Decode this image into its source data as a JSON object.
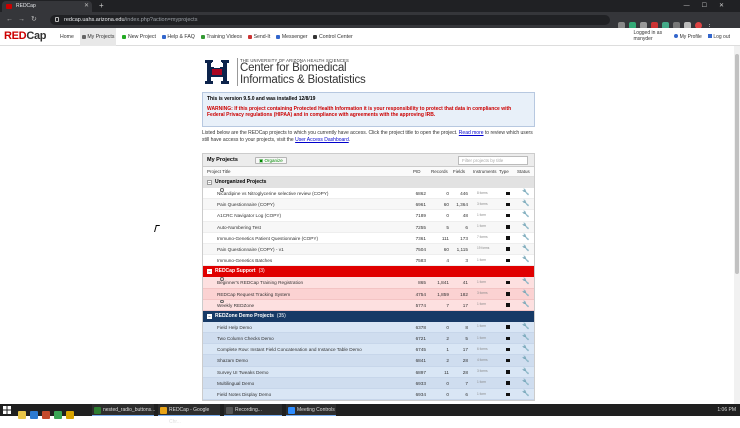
{
  "browser": {
    "tab_title": "REDCap",
    "url_host": "redcap.uahs.arizona.edu",
    "url_path": "/index.php?action=myprojects"
  },
  "nav": {
    "logo_red": "RED",
    "logo_dark": "Cap",
    "items": [
      {
        "label": "Home",
        "color": "#666"
      },
      {
        "label": "My Projects",
        "color": "#666",
        "active": true
      },
      {
        "label": "New Project",
        "color": "#2a2"
      },
      {
        "label": "Help & FAQ",
        "color": "#36c"
      },
      {
        "label": "Training Videos",
        "color": "#393"
      },
      {
        "label": "Send-It",
        "color": "#c33"
      },
      {
        "label": "Messenger",
        "color": "#36c"
      },
      {
        "label": "Control Center",
        "color": "#333"
      }
    ],
    "logged_line1": "Logged in as",
    "logged_line2": "msnyder",
    "my_profile": "My Profile",
    "log_out": "Log out"
  },
  "header": {
    "univ": "THE UNIVERSITY OF ARIZONA HEALTH SCIENCES",
    "center_line1": "Center for Biomedical",
    "center_line2": "Informatics & Biostatistics"
  },
  "notice": {
    "version": "This is version 9.5.0 and was installed 12/8/19",
    "warning": "WARNING: If this project containing Protected Health Information it is your responsibility to protect that data in compliance with Federal Privacy regulations (HIPAA) and in compliance with agreements with the approving IRB."
  },
  "intro": {
    "text1": "Listed below are the REDCap projects to which you currently have access. Click the project title to open the project.",
    "read_more": "Read more",
    "text2": "to review which users still have access to your projects, visit the",
    "dashboard_link": "User Access Dashboard"
  },
  "projects": {
    "title": "My Projects",
    "organize": "Organize",
    "filter_placeholder": "Filter projects by title",
    "columns": {
      "title": "Project Title",
      "pid": "PID",
      "records": "Records",
      "fields": "Fields",
      "instruments": "Instruments",
      "type": "Type",
      "status": "Status"
    },
    "folders": [
      {
        "name": "Unorganized Projects",
        "count": "",
        "style": "gray",
        "rows": [
          {
            "name": "Nicardipine vs Nitroglycerine selective review (COPY)",
            "q": true,
            "pid": "6862",
            "records": "0",
            "fields": "446",
            "instruments": "8 forms"
          },
          {
            "name": "Pain Questionnaire (COPY)",
            "q": false,
            "pid": "6961",
            "records": "60",
            "fields": "1,364",
            "instruments": "3 forms"
          },
          {
            "name": "A1CRC Navigator Log (COPY)",
            "q": false,
            "pid": "7189",
            "records": "0",
            "fields": "48",
            "instruments": "1 form"
          },
          {
            "name": "Auto-Numbering Test",
            "q": false,
            "pid": "7255",
            "records": "5",
            "fields": "6",
            "instruments": "1 form"
          },
          {
            "name": "Immuno-Genetics Patient Questionnaire (COPY)",
            "q": false,
            "pid": "7361",
            "records": "111",
            "fields": "173",
            "instruments": "7 forms"
          },
          {
            "name": "Pain Questionnaire (COPY) - v1",
            "q": false,
            "pid": "7504",
            "records": "60",
            "fields": "1,115",
            "instruments": "19 forms"
          },
          {
            "name": "Immuno-Genetics Batches",
            "q": false,
            "pid": "7583",
            "records": "4",
            "fields": "3",
            "instruments": "1 form"
          }
        ]
      },
      {
        "name": "REDCap Support",
        "count": "(3)",
        "style": "red",
        "rows": [
          {
            "name": "Beginner's REDCap Training Registration",
            "q": true,
            "pid": "865",
            "records": "1,841",
            "fields": "41",
            "instruments": "1 form"
          },
          {
            "name": "REDCap Request Tracking System",
            "q": false,
            "pid": "4754",
            "records": "1,859",
            "fields": "182",
            "instruments": "3 forms"
          },
          {
            "name": "Weekly REDZone",
            "q": true,
            "pid": "5774",
            "records": "7",
            "fields": "17",
            "instruments": "1 form"
          }
        ]
      },
      {
        "name": "REDZone Demo Projects",
        "count": "(35)",
        "style": "blue",
        "rows": [
          {
            "name": "Field Help Demo",
            "q": false,
            "pid": "6378",
            "records": "0",
            "fields": "8",
            "instruments": "1 form"
          },
          {
            "name": "Two Column Checks Demo",
            "q": false,
            "pid": "6721",
            "records": "2",
            "fields": "5",
            "instruments": "1 form"
          },
          {
            "name": "Complete Row: Instant Field Concatenation and Instance Table Demo",
            "q": false,
            "pid": "6745",
            "records": "1",
            "fields": "17",
            "instruments": "6 forms"
          },
          {
            "name": "Shazam Demo",
            "q": false,
            "pid": "6841",
            "records": "2",
            "fields": "28",
            "instruments": "4 forms"
          },
          {
            "name": "Survey UI Tweaks Demo",
            "q": false,
            "pid": "6897",
            "records": "11",
            "fields": "28",
            "instruments": "3 forms"
          },
          {
            "name": "Multilingual Demo",
            "q": false,
            "pid": "6933",
            "records": "0",
            "fields": "7",
            "instruments": "1 form"
          },
          {
            "name": "Field Notes Display Demo",
            "q": false,
            "pid": "6934",
            "records": "0",
            "fields": "6",
            "instruments": "1 form"
          }
        ]
      }
    ]
  },
  "taskbar": {
    "windows": [
      {
        "label": "nested_radio_buttons...",
        "color": "#2e7d32"
      },
      {
        "label": "REDCap - Google Chr...",
        "color": "#e8a317"
      },
      {
        "label": "Recording...",
        "color": "#555"
      },
      {
        "label": "Meeting Controls",
        "color": "#2d8cff"
      }
    ],
    "clock": "1:06 PM"
  }
}
